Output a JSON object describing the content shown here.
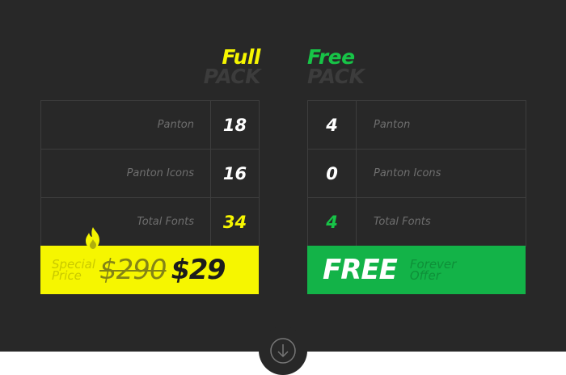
{
  "full_pack": {
    "title_line1": "Full",
    "title_line2": "PACK",
    "rows": [
      {
        "label": "Panton",
        "value": "18"
      },
      {
        "label": "Panton Icons",
        "value": "16"
      },
      {
        "label": "Total Fonts",
        "value": "34"
      }
    ],
    "special_label": "Special Price",
    "old_price": "$290",
    "new_price": "$29"
  },
  "free_pack": {
    "title_line1": "Free",
    "title_line2": "PACK",
    "rows": [
      {
        "label": "Panton",
        "value": "4"
      },
      {
        "label": "Panton Icons",
        "value": "0"
      },
      {
        "label": "Total Fonts",
        "value": "4"
      }
    ],
    "free_label": "FREE",
    "forever_label": "Forever Offer"
  },
  "icons": {
    "flame": "flame-icon",
    "scroll": "arrow-down-circle-icon"
  },
  "colors": {
    "background": "#282828",
    "accent_yellow": "#f6f600",
    "accent_green": "#13b348"
  }
}
